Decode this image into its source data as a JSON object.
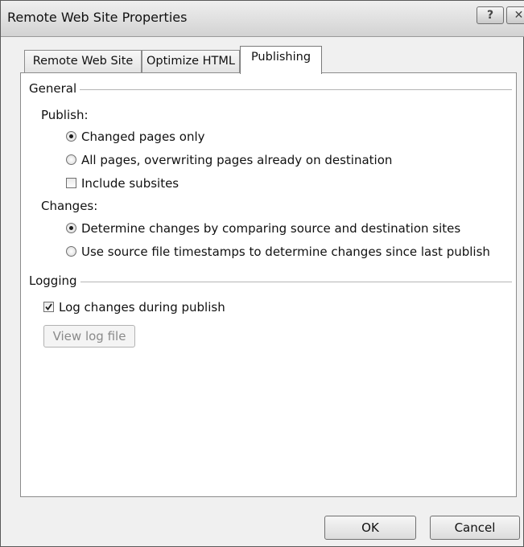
{
  "window": {
    "title": "Remote Web Site Properties",
    "help_label": "?",
    "close_label": "✕"
  },
  "tabs": [
    {
      "label": "Remote Web Site",
      "selected": false
    },
    {
      "label": "Optimize HTML",
      "selected": false
    },
    {
      "label": "Publishing",
      "selected": true
    }
  ],
  "general": {
    "heading": "General",
    "publish_label": "Publish:",
    "changed_pages_only": {
      "label": "Changed pages only",
      "checked": true
    },
    "all_pages": {
      "label": "All pages, overwriting pages already on destination",
      "checked": false
    },
    "include_subsites": {
      "label": "Include subsites",
      "checked": false
    },
    "changes_label": "Changes:",
    "determine_by_comparing": {
      "label": "Determine changes by comparing source and destination sites",
      "checked": true
    },
    "use_timestamps": {
      "label": "Use source file timestamps to determine changes since last publish",
      "checked": false
    }
  },
  "logging": {
    "heading": "Logging",
    "log_changes": {
      "label": "Log changes during publish",
      "checked": true
    },
    "view_log_label": "View log file"
  },
  "footer": {
    "ok_label": "OK",
    "cancel_label": "Cancel"
  }
}
